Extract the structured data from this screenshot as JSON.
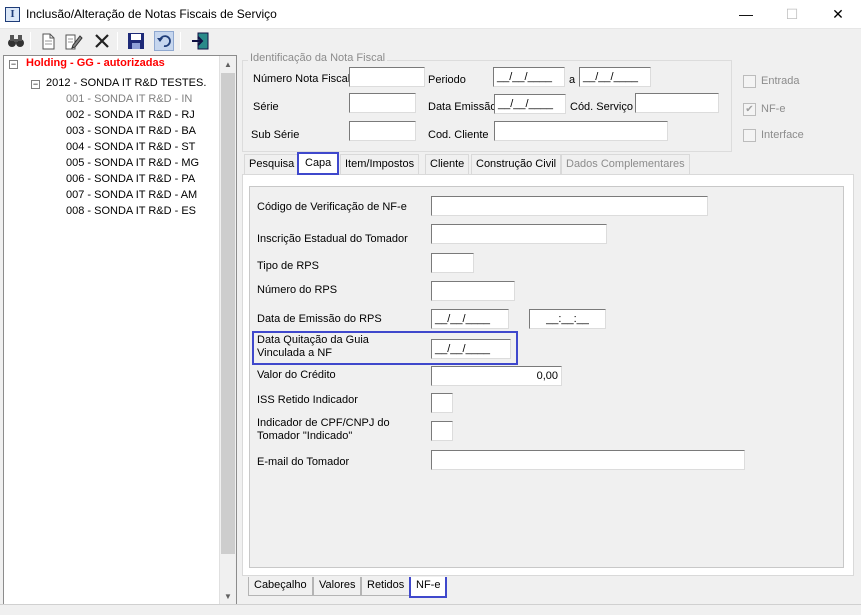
{
  "window": {
    "title": "Inclusão/Alteração de Notas Fiscais de Serviço",
    "app_icon_letter": "I",
    "minimize": "—",
    "maximize": "☐",
    "close": "✕"
  },
  "toolbar": {
    "icons": [
      "binoculars-icon",
      "new-document-icon",
      "edit-icon",
      "delete-icon",
      "save-icon",
      "undo-icon",
      "exit-icon"
    ]
  },
  "tree": {
    "root": "Holding -  GG -  autorizadas",
    "company": "2012 - SONDA IT R&D TESTES.",
    "branches": [
      "001 - SONDA IT R&D  - IN",
      "002 - SONDA IT R&D - RJ",
      "003 - SONDA IT R&D - BA",
      "004 - SONDA IT R&D - ST",
      "005 - SONDA IT R&D - MG",
      "006 - SONDA IT R&D - PA",
      "007 - SONDA IT R&D - AM",
      "008 - SONDA IT R&D - ES"
    ],
    "colors": {
      "root": "#ff0000",
      "selected_text": "#808080"
    }
  },
  "identificacao": {
    "title": "Identificação da Nota Fiscal",
    "numero_label": "Número Nota Fiscal",
    "numero_value": "",
    "periodo_label": "Periodo",
    "periodo_de": "__/__/____",
    "periodo_a_label": "a",
    "periodo_ate": "__/__/____",
    "serie_label": "Série",
    "serie_value": "",
    "data_emissao_label": "Data Emissão",
    "data_emissao_value": "__/__/____",
    "cod_servico_label": "Cód. Serviço",
    "cod_servico_value": "",
    "sub_serie_label": "Sub Série",
    "sub_serie_value": "",
    "cod_cliente_label": "Cod. Cliente",
    "cod_cliente_value": "",
    "entrada_label": "Entrada",
    "entrada_checked": false,
    "nfe_label": "NF-e",
    "nfe_checked": true,
    "interface_label": "Interface",
    "interface_checked": false
  },
  "tabs": [
    "Pesquisa",
    "Capa",
    "Item/Impostos",
    "Cliente",
    "Construção Civil",
    "Dados Complementares"
  ],
  "active_tab": "Capa",
  "nfe_form": {
    "codigo_verificacao_label": "Código de Verificação de NF-e",
    "codigo_verificacao_value": "",
    "inscricao_estadual_label": "Inscrição Estadual do Tomador",
    "inscricao_estadual_value": "",
    "tipo_rps_label": "Tipo de RPS",
    "tipo_rps_value": "",
    "numero_rps_label": "Número do RPS",
    "numero_rps_value": "",
    "data_emissao_rps_label": "Data de Emissão do RPS",
    "data_emissao_rps_date": "__/__/____",
    "data_emissao_rps_time": "__:__:__",
    "data_quitacao_label_1": "Data Quitação da Guia",
    "data_quitacao_label_2": "Vinculada a NF",
    "data_quitacao_value": "__/__/____",
    "valor_credito_label": "Valor do Crédito",
    "valor_credito_value": "0,00",
    "iss_retido_label": "ISS Retido Indicador",
    "iss_retido_value": "",
    "indicador_cpf_label_1": "Indicador de CPF/CNPJ do",
    "indicador_cpf_label_2": "Tomador \"Indicado\"",
    "indicador_cpf_value": "",
    "email_tomador_label": "E-mail do Tomador",
    "email_tomador_value": ""
  },
  "bottom_tabs": [
    "Cabeçalho",
    "Valores",
    "Retidos",
    "NF-e"
  ],
  "active_bottom_tab": "NF-e",
  "colors": {
    "highlight": "#3f48cc",
    "window_bg": "#f0f0f0"
  }
}
